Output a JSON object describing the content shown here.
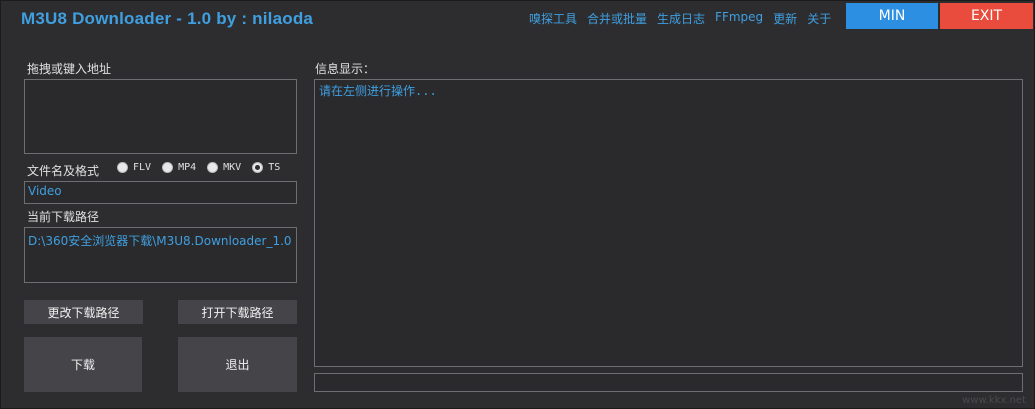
{
  "window": {
    "title": "M3U8 Downloader - 1.0  by : nilaoda"
  },
  "topnav": {
    "items": [
      "嗅探工具",
      "合并或批量",
      "生成日志",
      "FFmpeg",
      "更新",
      "关于"
    ]
  },
  "controls": {
    "min_label": "MIN",
    "exit_label": "EXIT"
  },
  "left": {
    "url_label": "拖拽或键入地址",
    "url_value": "",
    "filename_label": "文件名及格式",
    "formats": [
      {
        "label": "FLV",
        "checked": false
      },
      {
        "label": "MP4",
        "checked": false
      },
      {
        "label": "MKV",
        "checked": false
      },
      {
        "label": "TS",
        "checked": true
      }
    ],
    "filename_value": "Video",
    "path_label": "当前下载路径",
    "path_value": "D:\\360安全浏览器下载\\M3U8.Downloader_1.0",
    "change_path_button": "更改下载路径",
    "open_path_button": "打开下载路径",
    "download_button": "下载",
    "quit_button": "退出"
  },
  "right": {
    "info_label": "信息显示：",
    "log_text": "请在左侧进行操作...",
    "status_value": ""
  },
  "watermark": {
    "url": "www.kkx.net"
  },
  "colors": {
    "accent": "#3f9fe0",
    "min_button": "#2d8fe1",
    "exit_button": "#e94b3c",
    "background": "#2d2d30"
  }
}
